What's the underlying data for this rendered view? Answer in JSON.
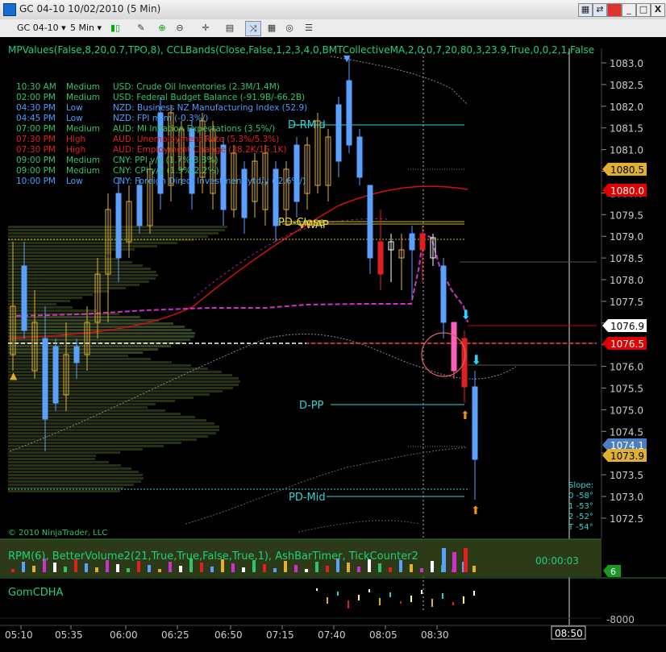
{
  "window": {
    "title": "GC 04-10  10/02/2010 (5 Min)",
    "minimize": "_",
    "maximize": "□",
    "close": "X"
  },
  "toolbar": {
    "instrument": "GC 04-10",
    "interval": "5 Min"
  },
  "indicator_header": "MPValues(False,8,20,0.7,TPO,8), CCLBands(Close,False,1,2,3,4,0,BMTCollectiveMA,2,0,0,7,20,80,3,23.9,True,0,0,2,1,False",
  "news": [
    {
      "time": "10:30 AM",
      "impact": "Medium",
      "text": "USD: Crude Oil Inventories (2.3M/1.4M)"
    },
    {
      "time": "02:00 PM",
      "impact": "Medium",
      "text": "USD: Federal Budget Balance (-91.9B/-66.2B)"
    },
    {
      "time": "04:30 PM",
      "impact": "Low",
      "text": "NZD: Business NZ Manufacturing Index (52.9)"
    },
    {
      "time": "04:45 PM",
      "impact": "Low",
      "text": "NZD: FPI m/m (-0.3%/)"
    },
    {
      "time": "07:00 PM",
      "impact": "Medium",
      "text": "AUD: MI Inflation Expectations (3.5%/)"
    },
    {
      "time": "07:30 PM",
      "impact": "High",
      "text": "AUD: Unemployment Rate (5.3%/5.3%)"
    },
    {
      "time": "07:30 PM",
      "impact": "High",
      "text": "AUD: Employment Change (38.2K/15.1K)"
    },
    {
      "time": "09:00 PM",
      "impact": "Medium",
      "text": "CNY: PPI y/y (1.7%/3.8%)"
    },
    {
      "time": "09:00 PM",
      "impact": "Medium",
      "text": "CNY: CPI y/y (1.9%/2.2%)"
    },
    {
      "time": "10:00 PM",
      "impact": "Low",
      "text": "CNY: Foreign Direct Investment ytd/y (-2.6%/)"
    }
  ],
  "levels": {
    "d_rmid": "D-RMid",
    "pd_close": "PD-Close",
    "vwap": "VWAP",
    "d_pp": "D-PP",
    "pd_mid": "PD-Mid"
  },
  "price_axis": [
    "1083.0",
    "1082.5",
    "1082.0",
    "1081.5",
    "1081.0",
    "1080.5",
    "1080.0",
    "1079.5",
    "1079.0",
    "1078.5",
    "1078.0",
    "1077.5",
    "1077.0",
    "1076.5",
    "1076.0",
    "1075.5",
    "1075.0",
    "1074.5",
    "1074.0",
    "1073.5",
    "1073.0",
    "1072.5"
  ],
  "price_tags": [
    {
      "label": "1080.5",
      "bg": "#e0b030",
      "fg": "#000"
    },
    {
      "label": "1080.0",
      "bg": "#e00000",
      "fg": "#fff"
    },
    {
      "label": "1076.9",
      "bg": "#ffffff",
      "fg": "#000"
    },
    {
      "label": "1076.5",
      "bg": "#e00000",
      "fg": "#fff"
    },
    {
      "label": "1074.1",
      "bg": "#4a7ec0",
      "fg": "#fff"
    },
    {
      "label": "1073.9",
      "bg": "#e0b030",
      "fg": "#000"
    }
  ],
  "slope": {
    "title": "Slope:",
    "rows": [
      "0  -58°",
      "1  -53°",
      "2  -52°",
      "T  -54°"
    ]
  },
  "copyright": "© 2010 NinjaTrader, LLC",
  "lower_panel": {
    "header": "RPM(6), BetterVolume2(21,True,True,False,True,1), AshBarTimer, TickCounter2",
    "timer": "00:00:03",
    "tag": "6"
  },
  "gom_panel": {
    "header": "GomCDHA",
    "axis_label": "-8000"
  },
  "time_axis": [
    "05:10",
    "05:35",
    "06:00",
    "06:25",
    "06:50",
    "07:15",
    "07:40",
    "08:05",
    "08:30"
  ],
  "time_cursor": "08:50",
  "colors": {
    "up": "#5aa0ff",
    "down": "#e0b030",
    "medium": "#2fc36a",
    "high": "#e02020",
    "low": "#4a9cff",
    "green_text": "#1fd07a",
    "level": "#2ed5d5"
  }
}
